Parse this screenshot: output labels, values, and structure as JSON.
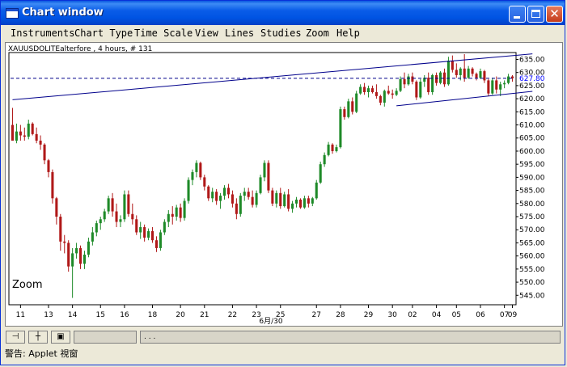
{
  "window": {
    "title": "Chart window"
  },
  "menu": [
    "Instruments",
    "Chart Type",
    "Time Scale",
    "View",
    "Lines",
    "Studies",
    "Zoom",
    "Help"
  ],
  "chart": {
    "header": "XAUUSDOLITEalterfore , 4 hours, # 131",
    "zoom_label": "Zoom",
    "current_price_label": "627.80",
    "colors": {
      "up": "#1e8a28",
      "down": "#b01818",
      "trend": "#00008b",
      "price_line": "#00008b",
      "price_label": "#0000ff"
    }
  },
  "chart_data": {
    "type": "candlestick",
    "title": "XAUUSDOLITEalterfore , 4 hours, # 131",
    "y_ticks": [
      "635.00",
      "630.00",
      "625.00",
      "620.00",
      "615.00",
      "610.00",
      "605.00",
      "600.00",
      "595.00",
      "590.00",
      "585.00",
      "580.00",
      "575.00",
      "570.00",
      "565.00",
      "560.00",
      "555.00",
      "550.00",
      "545.00"
    ],
    "ylim": [
      542,
      637
    ],
    "x_ticks": [
      "11",
      "13",
      "14",
      "15",
      "16",
      "18",
      "20",
      "21",
      "22",
      "23",
      "25",
      "27",
      "28",
      "29",
      "30",
      "02",
      "04",
      "05",
      "06",
      "07",
      "09"
    ],
    "x_sublabel": "6月/30",
    "current_price": 627.8,
    "trend_lines": [
      {
        "from": [
          0,
          619.6
        ],
        "to": [
          130,
          637.1
        ]
      },
      {
        "from": [
          96,
          617.3
        ],
        "to": [
          130,
          622.8
        ]
      }
    ],
    "candles": [
      [
        610.0,
        616.5,
        608.0,
        604.0
      ],
      [
        604.0,
        610.5,
        603.0,
        607.5
      ],
      [
        607.5,
        610.0,
        604.0,
        606.0
      ],
      [
        606.0,
        609.0,
        604.0,
        605.5
      ],
      [
        605.5,
        612.0,
        604.5,
        610.5
      ],
      [
        610.5,
        611.0,
        606.0,
        606.5
      ],
      [
        606.5,
        609.0,
        603.0,
        604.0
      ],
      [
        604.0,
        606.0,
        600.5,
        602.5
      ],
      [
        602.5,
        603.0,
        595.0,
        596.5
      ],
      [
        596.5,
        597.0,
        590.0,
        592.0
      ],
      [
        592.0,
        593.0,
        580.0,
        582.0
      ],
      [
        582.0,
        582.5,
        572.0,
        575.0
      ],
      [
        575.0,
        576.0,
        562.0,
        565.5
      ],
      [
        565.5,
        568.0,
        561.0,
        565.0
      ],
      [
        565.0,
        566.0,
        554.0,
        556.0
      ],
      [
        556.0,
        563.0,
        544.0,
        561.0
      ],
      [
        561.0,
        565.0,
        559.0,
        563.0
      ],
      [
        563.0,
        564.0,
        555.0,
        557.0
      ],
      [
        557.0,
        562.0,
        555.0,
        560.5
      ],
      [
        560.5,
        567.0,
        559.5,
        565.5
      ],
      [
        565.5,
        571.0,
        564.0,
        569.0
      ],
      [
        569.0,
        573.5,
        567.5,
        572.5
      ],
      [
        572.5,
        575.0,
        570.0,
        574.0
      ],
      [
        574.0,
        578.0,
        573.0,
        577.0
      ],
      [
        577.0,
        583.0,
        576.0,
        582.0
      ],
      [
        582.0,
        584.0,
        575.0,
        577.0
      ],
      [
        577.0,
        580.0,
        571.0,
        573.0
      ],
      [
        573.0,
        575.5,
        571.0,
        574.0
      ],
      [
        574.0,
        585.0,
        573.0,
        583.5
      ],
      [
        583.5,
        585.0,
        575.0,
        576.0
      ],
      [
        576.0,
        580.0,
        572.0,
        574.0
      ],
      [
        574.0,
        575.5,
        568.0,
        569.0
      ],
      [
        569.0,
        573.0,
        566.5,
        571.0
      ],
      [
        571.0,
        572.0,
        565.5,
        567.0
      ],
      [
        567.0,
        570.5,
        566.0,
        569.5
      ],
      [
        569.5,
        571.0,
        565.0,
        566.0
      ],
      [
        566.0,
        567.5,
        561.5,
        563.0
      ],
      [
        563.0,
        570.0,
        562.0,
        569.0
      ],
      [
        569.0,
        574.0,
        568.0,
        573.0
      ],
      [
        573.0,
        577.5,
        571.0,
        576.0
      ],
      [
        576.0,
        579.0,
        572.0,
        575.0
      ],
      [
        575.0,
        579.5,
        573.5,
        578.5
      ],
      [
        578.5,
        580.0,
        573.0,
        574.5
      ],
      [
        574.5,
        582.0,
        573.5,
        581.0
      ],
      [
        581.0,
        590.0,
        580.0,
        589.0
      ],
      [
        589.0,
        593.0,
        587.0,
        592.0
      ],
      [
        592.0,
        596.5,
        590.0,
        595.5
      ],
      [
        595.5,
        596.0,
        589.0,
        590.0
      ],
      [
        590.0,
        591.0,
        585.0,
        586.5
      ],
      [
        586.5,
        587.0,
        581.0,
        582.0
      ],
      [
        582.0,
        586.0,
        580.5,
        584.5
      ],
      [
        584.5,
        585.5,
        579.5,
        581.0
      ],
      [
        581.0,
        584.0,
        578.0,
        583.0
      ],
      [
        583.0,
        587.0,
        581.5,
        586.0
      ],
      [
        586.0,
        587.5,
        582.0,
        583.5
      ],
      [
        583.5,
        585.0,
        578.5,
        580.0
      ],
      [
        580.0,
        582.0,
        574.0,
        576.0
      ],
      [
        576.0,
        584.0,
        575.0,
        583.0
      ],
      [
        583.0,
        586.0,
        581.0,
        584.5
      ],
      [
        584.5,
        586.0,
        581.5,
        582.5
      ],
      [
        582.5,
        585.0,
        578.5,
        579.5
      ],
      [
        579.5,
        585.0,
        578.5,
        584.0
      ],
      [
        584.0,
        591.0,
        583.5,
        590.0
      ],
      [
        590.0,
        596.5,
        588.5,
        595.5
      ],
      [
        595.5,
        596.5,
        584.0,
        585.0
      ],
      [
        585.0,
        586.0,
        579.0,
        580.0
      ],
      [
        580.0,
        585.0,
        578.5,
        584.0
      ],
      [
        584.0,
        586.0,
        578.0,
        579.0
      ],
      [
        579.0,
        584.5,
        578.5,
        583.5
      ],
      [
        583.5,
        585.5,
        577.0,
        578.0
      ],
      [
        578.0,
        581.0,
        576.5,
        580.0
      ],
      [
        580.0,
        582.5,
        578.5,
        581.5
      ],
      [
        581.5,
        582.0,
        578.0,
        578.5
      ],
      [
        578.5,
        583.0,
        578.0,
        582.0
      ],
      [
        582.0,
        583.0,
        578.5,
        580.0
      ],
      [
        580.0,
        582.5,
        579.0,
        582.0
      ],
      [
        582.0,
        589.0,
        581.5,
        588.0
      ],
      [
        588.0,
        596.0,
        587.5,
        595.0
      ],
      [
        595.0,
        599.5,
        594.0,
        598.5
      ],
      [
        598.5,
        603.5,
        598.0,
        602.5
      ],
      [
        602.5,
        603.0,
        599.0,
        600.0
      ],
      [
        600.0,
        602.5,
        599.5,
        601.5
      ],
      [
        601.5,
        617.0,
        601.0,
        616.0
      ],
      [
        616.0,
        617.0,
        612.0,
        613.0
      ],
      [
        613.0,
        620.0,
        612.5,
        619.0
      ],
      [
        619.0,
        620.5,
        614.0,
        615.0
      ],
      [
        615.0,
        623.0,
        614.5,
        622.0
      ],
      [
        622.0,
        625.5,
        621.5,
        624.5
      ],
      [
        624.5,
        626.0,
        621.5,
        622.5
      ],
      [
        622.5,
        625.0,
        620.5,
        624.0
      ],
      [
        624.0,
        625.0,
        622.0,
        622.5
      ],
      [
        622.5,
        625.5,
        620.0,
        621.0
      ],
      [
        621.0,
        621.5,
        617.5,
        618.5
      ],
      [
        618.5,
        623.5,
        617.0,
        623.0
      ],
      [
        623.0,
        625.0,
        621.5,
        622.0
      ],
      [
        622.0,
        623.5,
        620.0,
        621.5
      ],
      [
        621.5,
        624.0,
        621.0,
        623.0
      ],
      [
        623.0,
        628.5,
        622.5,
        627.5
      ],
      [
        627.5,
        630.0,
        624.0,
        625.5
      ],
      [
        625.5,
        629.5,
        625.0,
        628.5
      ],
      [
        628.5,
        630.0,
        625.5,
        626.5
      ],
      [
        626.5,
        627.0,
        619.5,
        620.5
      ],
      [
        620.5,
        627.5,
        620.0,
        626.5
      ],
      [
        626.5,
        629.0,
        624.5,
        628.0
      ],
      [
        628.0,
        630.0,
        621.5,
        622.5
      ],
      [
        622.5,
        629.5,
        621.5,
        629.0
      ],
      [
        629.0,
        630.0,
        625.0,
        626.0
      ],
      [
        626.0,
        630.5,
        625.5,
        630.0
      ],
      [
        630.0,
        631.5,
        624.5,
        625.5
      ],
      [
        625.5,
        636.0,
        625.0,
        634.5
      ],
      [
        634.5,
        636.5,
        630.0,
        631.0
      ],
      [
        631.0,
        633.5,
        628.0,
        629.0
      ],
      [
        629.0,
        632.0,
        627.0,
        631.5
      ],
      [
        631.5,
        637.0,
        626.5,
        628.0
      ],
      [
        628.0,
        632.5,
        627.5,
        631.5
      ],
      [
        631.5,
        632.0,
        628.5,
        629.5
      ],
      [
        629.5,
        630.0,
        627.0,
        628.0
      ],
      [
        628.0,
        631.5,
        627.5,
        630.5
      ],
      [
        630.5,
        631.0,
        626.0,
        627.0
      ],
      [
        627.0,
        627.5,
        621.0,
        622.0
      ],
      [
        622.0,
        628.0,
        621.5,
        627.0
      ],
      [
        627.0,
        628.5,
        622.0,
        623.5
      ],
      [
        623.5,
        626.5,
        621.0,
        625.5
      ],
      [
        625.5,
        627.0,
        624.0,
        626.0
      ],
      [
        626.0,
        629.5,
        625.5,
        628.5
      ],
      [
        628.5,
        629.0,
        626.5,
        627.8
      ]
    ]
  },
  "status": {
    "field_text": ". . .",
    "applet_warning": "警告: Applet 視窗"
  }
}
